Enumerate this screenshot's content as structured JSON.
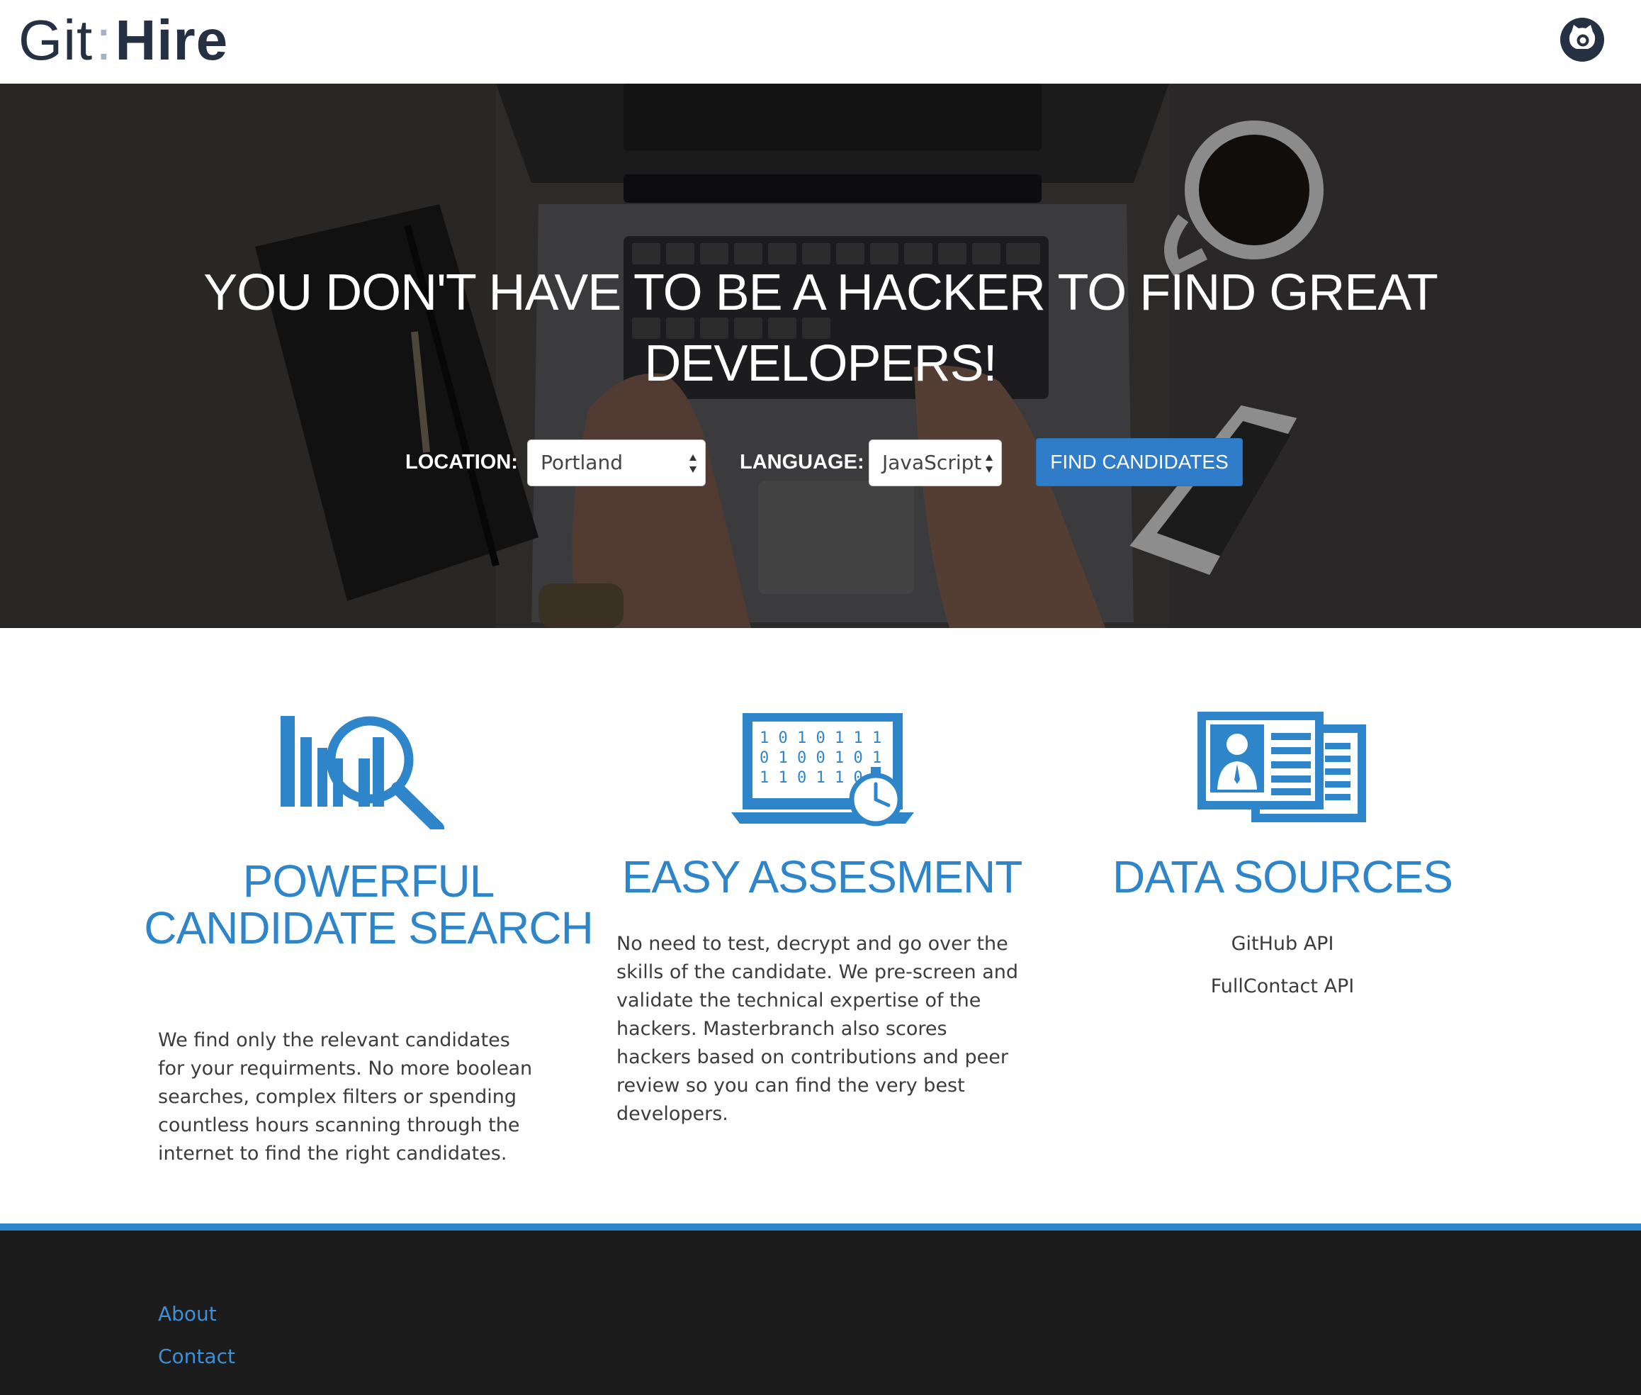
{
  "header": {
    "logo_git": "Git",
    "logo_sep": ":",
    "logo_hire": "Hire",
    "github_icon": "github-octocat-icon"
  },
  "hero": {
    "title": "YOU DON'T HAVE TO BE A HACKER TO FIND GREAT DEVELOPERS!",
    "location_label": "LOCATION:",
    "location_value": "Portland",
    "language_label": "LANGUAGE:",
    "language_value": "JavaScript",
    "button_label": "FIND CANDIDATES"
  },
  "features": [
    {
      "icon": "bar-chart-magnifier-icon",
      "title": "POWERFUL CANDIDATE SEARCH",
      "text": "We find only the relevant candidates for your requirments. No more boolean searches, complex filters or spending countless hours scanning through the internet to find the right candidates."
    },
    {
      "icon": "binary-screen-stopwatch-icon",
      "title": "EASY ASSESMENT",
      "text": "No need to test, decrypt and go over the skills of the candidate. We pre-screen and validate the technical expertise of the hackers. Masterbranch also scores hackers based on contributions and peer review so you can find the very best developers."
    },
    {
      "icon": "profile-card-icon",
      "title": "DATA SOURCES",
      "sources": [
        "GitHub API",
        "FullContact API"
      ]
    }
  ],
  "icon_digits": [
    "1 0 1 0 1 1 1 1",
    "0 1 0 0 1 0 1",
    "1 1 0 1 1 0"
  ],
  "footer": {
    "links": [
      "About",
      "Contact"
    ]
  },
  "colors": {
    "accent": "#2f85c9",
    "button": "#2f7dc9",
    "logo": "#263043",
    "footer_bg": "#1c1c1c"
  }
}
